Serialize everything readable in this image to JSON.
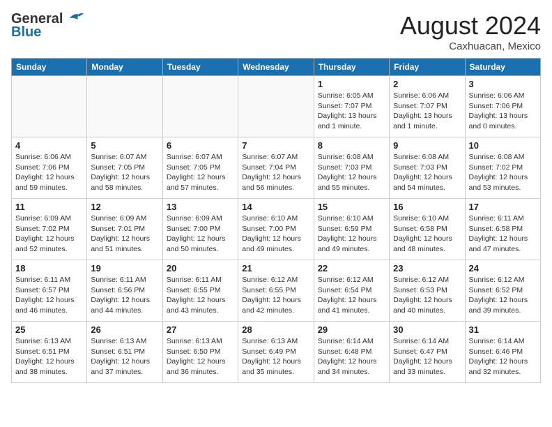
{
  "header": {
    "logo_general": "General",
    "logo_blue": "Blue",
    "month_year": "August 2024",
    "location": "Caxhuacan, Mexico"
  },
  "days_of_week": [
    "Sunday",
    "Monday",
    "Tuesday",
    "Wednesday",
    "Thursday",
    "Friday",
    "Saturday"
  ],
  "weeks": [
    [
      {
        "day": "",
        "sunrise": "",
        "sunset": "",
        "daylight": ""
      },
      {
        "day": "",
        "sunrise": "",
        "sunset": "",
        "daylight": ""
      },
      {
        "day": "",
        "sunrise": "",
        "sunset": "",
        "daylight": ""
      },
      {
        "day": "",
        "sunrise": "",
        "sunset": "",
        "daylight": ""
      },
      {
        "day": "1",
        "sunrise": "Sunrise: 6:05 AM",
        "sunset": "Sunset: 7:07 PM",
        "daylight": "Daylight: 13 hours and 1 minute."
      },
      {
        "day": "2",
        "sunrise": "Sunrise: 6:06 AM",
        "sunset": "Sunset: 7:07 PM",
        "daylight": "Daylight: 13 hours and 1 minute."
      },
      {
        "day": "3",
        "sunrise": "Sunrise: 6:06 AM",
        "sunset": "Sunset: 7:06 PM",
        "daylight": "Daylight: 13 hours and 0 minutes."
      }
    ],
    [
      {
        "day": "4",
        "sunrise": "Sunrise: 6:06 AM",
        "sunset": "Sunset: 7:06 PM",
        "daylight": "Daylight: 12 hours and 59 minutes."
      },
      {
        "day": "5",
        "sunrise": "Sunrise: 6:07 AM",
        "sunset": "Sunset: 7:05 PM",
        "daylight": "Daylight: 12 hours and 58 minutes."
      },
      {
        "day": "6",
        "sunrise": "Sunrise: 6:07 AM",
        "sunset": "Sunset: 7:05 PM",
        "daylight": "Daylight: 12 hours and 57 minutes."
      },
      {
        "day": "7",
        "sunrise": "Sunrise: 6:07 AM",
        "sunset": "Sunset: 7:04 PM",
        "daylight": "Daylight: 12 hours and 56 minutes."
      },
      {
        "day": "8",
        "sunrise": "Sunrise: 6:08 AM",
        "sunset": "Sunset: 7:03 PM",
        "daylight": "Daylight: 12 hours and 55 minutes."
      },
      {
        "day": "9",
        "sunrise": "Sunrise: 6:08 AM",
        "sunset": "Sunset: 7:03 PM",
        "daylight": "Daylight: 12 hours and 54 minutes."
      },
      {
        "day": "10",
        "sunrise": "Sunrise: 6:08 AM",
        "sunset": "Sunset: 7:02 PM",
        "daylight": "Daylight: 12 hours and 53 minutes."
      }
    ],
    [
      {
        "day": "11",
        "sunrise": "Sunrise: 6:09 AM",
        "sunset": "Sunset: 7:02 PM",
        "daylight": "Daylight: 12 hours and 52 minutes."
      },
      {
        "day": "12",
        "sunrise": "Sunrise: 6:09 AM",
        "sunset": "Sunset: 7:01 PM",
        "daylight": "Daylight: 12 hours and 51 minutes."
      },
      {
        "day": "13",
        "sunrise": "Sunrise: 6:09 AM",
        "sunset": "Sunset: 7:00 PM",
        "daylight": "Daylight: 12 hours and 50 minutes."
      },
      {
        "day": "14",
        "sunrise": "Sunrise: 6:10 AM",
        "sunset": "Sunset: 7:00 PM",
        "daylight": "Daylight: 12 hours and 49 minutes."
      },
      {
        "day": "15",
        "sunrise": "Sunrise: 6:10 AM",
        "sunset": "Sunset: 6:59 PM",
        "daylight": "Daylight: 12 hours and 49 minutes."
      },
      {
        "day": "16",
        "sunrise": "Sunrise: 6:10 AM",
        "sunset": "Sunset: 6:58 PM",
        "daylight": "Daylight: 12 hours and 48 minutes."
      },
      {
        "day": "17",
        "sunrise": "Sunrise: 6:11 AM",
        "sunset": "Sunset: 6:58 PM",
        "daylight": "Daylight: 12 hours and 47 minutes."
      }
    ],
    [
      {
        "day": "18",
        "sunrise": "Sunrise: 6:11 AM",
        "sunset": "Sunset: 6:57 PM",
        "daylight": "Daylight: 12 hours and 46 minutes."
      },
      {
        "day": "19",
        "sunrise": "Sunrise: 6:11 AM",
        "sunset": "Sunset: 6:56 PM",
        "daylight": "Daylight: 12 hours and 44 minutes."
      },
      {
        "day": "20",
        "sunrise": "Sunrise: 6:11 AM",
        "sunset": "Sunset: 6:55 PM",
        "daylight": "Daylight: 12 hours and 43 minutes."
      },
      {
        "day": "21",
        "sunrise": "Sunrise: 6:12 AM",
        "sunset": "Sunset: 6:55 PM",
        "daylight": "Daylight: 12 hours and 42 minutes."
      },
      {
        "day": "22",
        "sunrise": "Sunrise: 6:12 AM",
        "sunset": "Sunset: 6:54 PM",
        "daylight": "Daylight: 12 hours and 41 minutes."
      },
      {
        "day": "23",
        "sunrise": "Sunrise: 6:12 AM",
        "sunset": "Sunset: 6:53 PM",
        "daylight": "Daylight: 12 hours and 40 minutes."
      },
      {
        "day": "24",
        "sunrise": "Sunrise: 6:12 AM",
        "sunset": "Sunset: 6:52 PM",
        "daylight": "Daylight: 12 hours and 39 minutes."
      }
    ],
    [
      {
        "day": "25",
        "sunrise": "Sunrise: 6:13 AM",
        "sunset": "Sunset: 6:51 PM",
        "daylight": "Daylight: 12 hours and 38 minutes."
      },
      {
        "day": "26",
        "sunrise": "Sunrise: 6:13 AM",
        "sunset": "Sunset: 6:51 PM",
        "daylight": "Daylight: 12 hours and 37 minutes."
      },
      {
        "day": "27",
        "sunrise": "Sunrise: 6:13 AM",
        "sunset": "Sunset: 6:50 PM",
        "daylight": "Daylight: 12 hours and 36 minutes."
      },
      {
        "day": "28",
        "sunrise": "Sunrise: 6:13 AM",
        "sunset": "Sunset: 6:49 PM",
        "daylight": "Daylight: 12 hours and 35 minutes."
      },
      {
        "day": "29",
        "sunrise": "Sunrise: 6:14 AM",
        "sunset": "Sunset: 6:48 PM",
        "daylight": "Daylight: 12 hours and 34 minutes."
      },
      {
        "day": "30",
        "sunrise": "Sunrise: 6:14 AM",
        "sunset": "Sunset: 6:47 PM",
        "daylight": "Daylight: 12 hours and 33 minutes."
      },
      {
        "day": "31",
        "sunrise": "Sunrise: 6:14 AM",
        "sunset": "Sunset: 6:46 PM",
        "daylight": "Daylight: 12 hours and 32 minutes."
      }
    ]
  ]
}
